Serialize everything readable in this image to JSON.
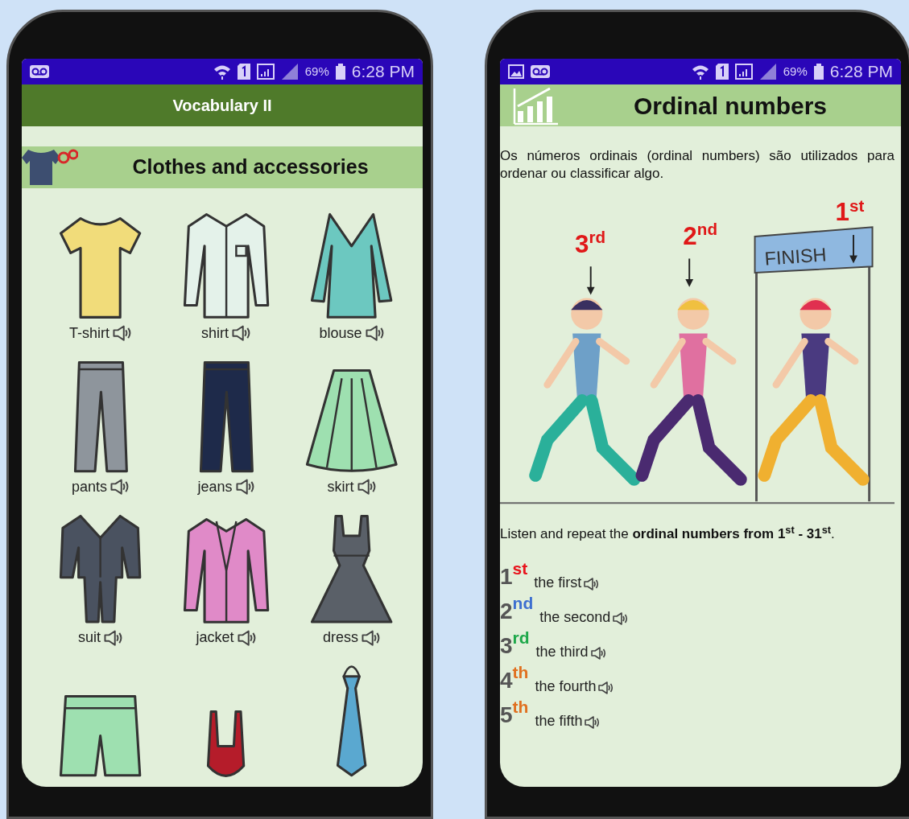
{
  "left_phone": {
    "status_bar": {
      "notifications": [
        {
          "kind": "voicemail"
        }
      ],
      "battery": "69%",
      "time": "6:28 PM"
    },
    "app_bar": {
      "title": "Vocabulary II"
    },
    "section": {
      "title": "Clothes and accessories"
    },
    "items": [
      {
        "label": "T-shirt",
        "kind": "tshirt",
        "color": "#f1dc7a"
      },
      {
        "label": "shirt",
        "kind": "shirt",
        "color": "#e4f2ea"
      },
      {
        "label": "blouse",
        "kind": "blouse",
        "color": "#6cc8c0"
      },
      {
        "label": "pants",
        "kind": "pants",
        "color": "#8e959c"
      },
      {
        "label": "jeans",
        "kind": "pants",
        "color": "#1e2a4a"
      },
      {
        "label": "skirt",
        "kind": "skirt",
        "color": "#9ee0b0"
      },
      {
        "label": "suit",
        "kind": "suit",
        "color": "#4a5260"
      },
      {
        "label": "jacket",
        "kind": "jacket",
        "color": "#e08ac8"
      },
      {
        "label": "dress",
        "kind": "dress",
        "color": "#5a6068"
      }
    ],
    "partial_items": [
      {
        "kind": "shorts",
        "color": "#9ee0b0"
      },
      {
        "kind": "swimsuit",
        "color": "#b51c2a"
      },
      {
        "kind": "tie",
        "color": "#5aa8d0"
      }
    ]
  },
  "right_phone": {
    "status_bar": {
      "notifications": [
        {
          "kind": "image"
        },
        {
          "kind": "voicemail"
        }
      ],
      "battery": "69%",
      "time": "6:28 PM"
    },
    "header": {
      "title": "Ordinal numbers"
    },
    "intro": "Os números ordinais (ordinal numbers) são utilizados para ordenar ou classificar algo.",
    "illustration": {
      "sign": "FINISH",
      "places": [
        {
          "number": "3",
          "suffix": "rd"
        },
        {
          "number": "2",
          "suffix": "nd"
        },
        {
          "number": "1",
          "suffix": "st"
        }
      ]
    },
    "instruction": "Listen and repeat the **ordinal numbers from 1**$^{st}$ **- 31**$^{st}$.",
    "ordinals": [
      {
        "number": "1",
        "suffix": "st",
        "color": "#e8141c",
        "word": "the first"
      },
      {
        "number": "2",
        "suffix": "nd",
        "color": "#3d6fd0",
        "word": "the second"
      },
      {
        "number": "3",
        "suffix": "rd",
        "color": "#1ea84a",
        "word": "the third"
      },
      {
        "number": "4",
        "suffix": "th",
        "color": "#e07020",
        "word": "the fourth"
      },
      {
        "number": "5",
        "suffix": "th",
        "color": "#e07020",
        "word": "the fifth"
      }
    ]
  }
}
